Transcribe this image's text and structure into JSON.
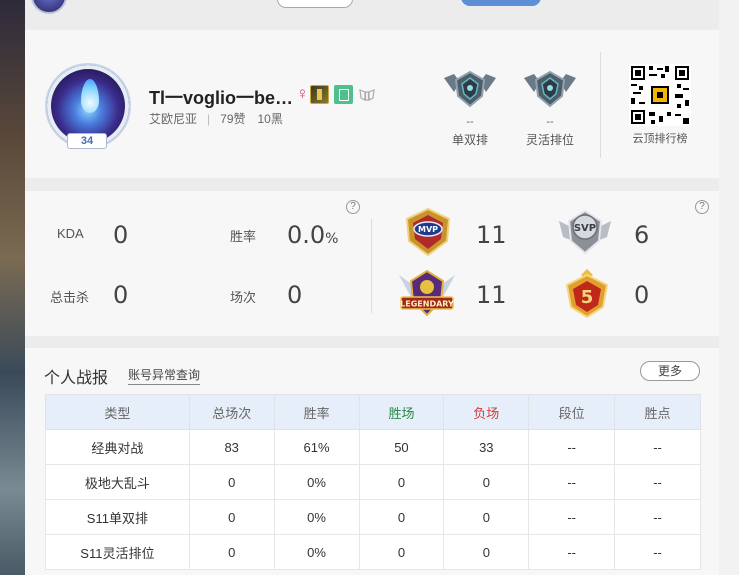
{
  "profile": {
    "name": "Tl一voglio一be…",
    "gender_symbol": "♀",
    "level": "34",
    "server": "艾欧尼亚",
    "likes": "79赞",
    "blacks": "10黑",
    "ranks": [
      {
        "value": "--",
        "label": "单双排"
      },
      {
        "value": "--",
        "label": "灵活排位"
      }
    ],
    "qr_label": "云顶排行榜"
  },
  "stats": {
    "kda_label": "KDA",
    "kda_value": "0",
    "winrate_label": "胜率",
    "winrate_value": "0.0",
    "winrate_unit": "%",
    "kills_label": "总击杀",
    "kills_value": "0",
    "games_label": "场次",
    "games_value": "0",
    "help_symbol": "?",
    "medals": [
      {
        "name": "MVP",
        "count": "11"
      },
      {
        "name": "SVP",
        "count": "6"
      },
      {
        "name": "LEGENDARY",
        "count": "11"
      },
      {
        "name": "5",
        "count": "0"
      }
    ]
  },
  "report": {
    "title": "个人战报",
    "link": "账号异常查询",
    "more": "更多",
    "headers": [
      "类型",
      "总场次",
      "胜率",
      "胜场",
      "负场",
      "段位",
      "胜点"
    ],
    "rows": [
      [
        "经典对战",
        "83",
        "61%",
        "50",
        "33",
        "--",
        "--"
      ],
      [
        "极地大乱斗",
        "0",
        "0%",
        "0",
        "0",
        "--",
        "--"
      ],
      [
        "S11单双排",
        "0",
        "0%",
        "0",
        "0",
        "--",
        "--"
      ],
      [
        "S11灵活排位",
        "0",
        "0%",
        "0",
        "0",
        "--",
        "--"
      ]
    ]
  },
  "colors": {
    "win": "#2a8a4a",
    "lose": "#d43a3a",
    "header_bg": "#e6eff9",
    "accent": "#5c8fd6"
  }
}
